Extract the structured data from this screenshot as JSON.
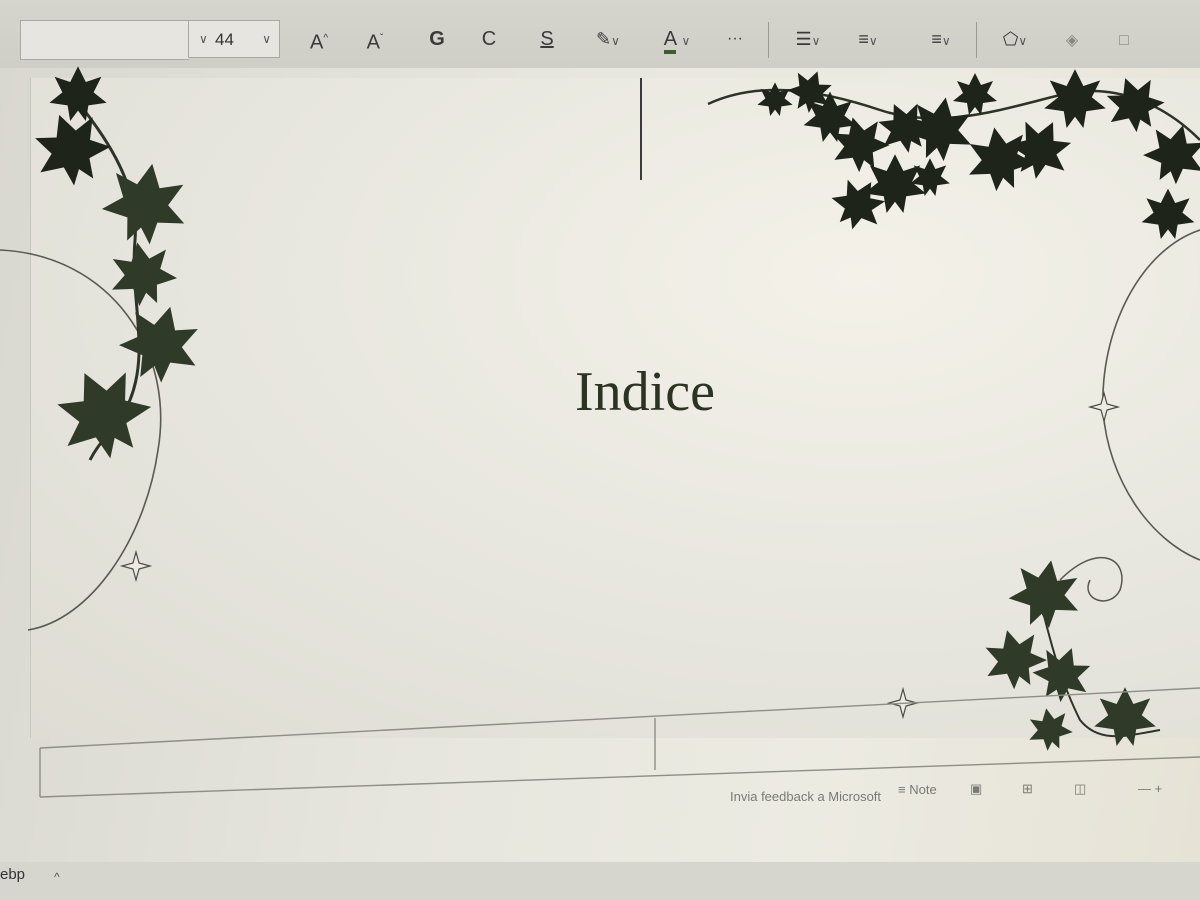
{
  "ribbon": {
    "font_name": "",
    "font_size": "44",
    "grow_font": "A",
    "shrink_font": "A",
    "bold": "G",
    "italic": "C",
    "underline": "S",
    "font_color": "A",
    "more": "···"
  },
  "slide": {
    "title": "Indice"
  },
  "status": {
    "feedback": "Invia feedback a Microsoft",
    "notes": "Note"
  },
  "taskbar": {
    "label": "ebp"
  },
  "colors": {
    "ivy_leaf": "#1f241b",
    "ivy_leaf_light": "#2f3a29",
    "title": "#2c3322",
    "ribbon_bg": "#d5d4cd"
  }
}
